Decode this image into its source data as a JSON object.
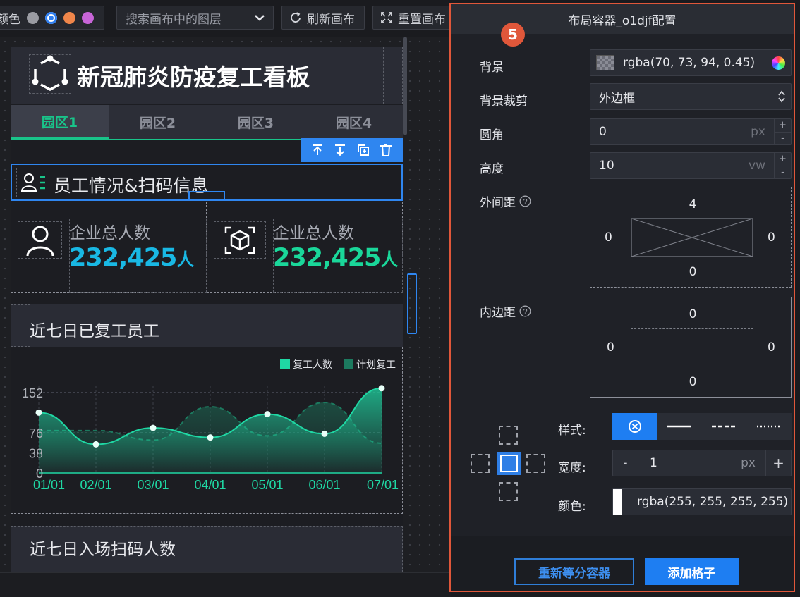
{
  "toolbar": {
    "color_label": "颜色",
    "theme_colors": [
      "#9b9ca3",
      "#2f7ff0",
      "#f0864a",
      "#c865d8"
    ],
    "layer_search_placeholder": "搜索画布中的图层",
    "refresh_label": "刷新画布",
    "reset_label": "重置画布"
  },
  "dashboard": {
    "title": "新冠肺炎防疫复工看板",
    "tabs": [
      {
        "label": "园区1",
        "active": true
      },
      {
        "label": "园区2",
        "active": false
      },
      {
        "label": "园区3",
        "active": false
      },
      {
        "label": "园区4",
        "active": false
      }
    ],
    "section_employee_title": "员工情况&扫码信息",
    "stats": [
      {
        "label": "企业总人数",
        "value": "232,425",
        "unit": "人",
        "color": "#19b8e4"
      },
      {
        "label": "企业总人数",
        "value": "232,425",
        "unit": "人",
        "color": "#1ad79a"
      }
    ],
    "chart_title": "近七日已复工员工",
    "chart_title_2": "近七日入场扫码人数"
  },
  "chart_data": {
    "type": "line",
    "x": [
      "01/01",
      "02/01",
      "03/01",
      "04/01",
      "05/01",
      "06/01",
      "07/01"
    ],
    "series": [
      {
        "name": "复工人数",
        "values": [
          114,
          54,
          85,
          67,
          111,
          74,
          160
        ],
        "color": "#1fd8a4",
        "style": "solid-area"
      },
      {
        "name": "计划复工",
        "values": [
          80,
          80,
          62,
          125,
          70,
          133,
          56
        ],
        "color": "#1c7a5f",
        "style": "dashed-area"
      }
    ],
    "yticks": [
      0,
      38,
      76,
      152
    ],
    "ylim": [
      0,
      165
    ],
    "legend_position": "top-right",
    "grid": true
  },
  "panel": {
    "step_badge": "5",
    "title": "布局容器_o1djf配置",
    "background_label": "背景",
    "background_value": "rgba(70, 73, 94, 0.45)",
    "clip_label": "背景裁剪",
    "clip_value": "外边框",
    "radius_label": "圆角",
    "radius_value": "0",
    "radius_unit": "px",
    "height_label": "高度",
    "height_value": "10",
    "height_unit": "vw",
    "margin_label": "外间距",
    "margin": {
      "top": "4",
      "left": "0",
      "right": "0",
      "bottom": "0"
    },
    "padding_label": "内边距",
    "padding": {
      "top": "0",
      "left": "0",
      "right": "0",
      "bottom": "0"
    },
    "border_style_label": "样式:",
    "border_width_label": "宽度:",
    "border_width_value": "1",
    "border_width_unit": "px",
    "border_color_label": "颜色:",
    "border_color_value": "rgba(255, 255, 255, 255)",
    "minus": "-",
    "plus": "+",
    "spin_up": "+",
    "spin_down": "-",
    "reset_grid_button": "重新等分容器",
    "add_cell_button": "添加格子"
  }
}
